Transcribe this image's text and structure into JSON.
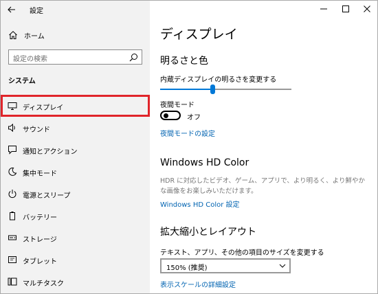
{
  "window": {
    "title": "設定"
  },
  "sidebar": {
    "home_label": "ホーム",
    "search_placeholder": "設定の検索",
    "section_title": "システム",
    "items": [
      {
        "label": "ディスプレイ",
        "icon": "monitor-icon"
      },
      {
        "label": "サウンド",
        "icon": "speaker-icon"
      },
      {
        "label": "通知とアクション",
        "icon": "notification-icon"
      },
      {
        "label": "集中モード",
        "icon": "moon-icon"
      },
      {
        "label": "電源とスリープ",
        "icon": "power-icon"
      },
      {
        "label": "バッテリー",
        "icon": "battery-icon"
      },
      {
        "label": "ストレージ",
        "icon": "storage-icon"
      },
      {
        "label": "タブレット",
        "icon": "tablet-icon"
      },
      {
        "label": "マルチタスク",
        "icon": "multitask-icon"
      }
    ],
    "selected_index": 0,
    "highlight_color": "#e0242a"
  },
  "main": {
    "page_title": "ディスプレイ",
    "brightness": {
      "heading": "明るさと色",
      "slider_label": "内蔵ディスプレイの明るさを変更する",
      "slider_value": 0.4,
      "night_light_label": "夜間モード",
      "night_light_state": "オフ",
      "night_light_link": "夜間モードの設定"
    },
    "hdr": {
      "heading": "Windows HD Color",
      "description": "HDR に対応したビデオ、ゲーム、アプリで、より明るく、より鮮やかな画像をお楽しみいただけます。",
      "link": "Windows HD Color 設定"
    },
    "scale": {
      "heading": "拡大縮小とレイアウト",
      "label": "テキスト、アプリ、その他の項目のサイズを変更する",
      "value": "150% (推奨)",
      "link": "表示スケールの詳細設定"
    },
    "accent_color": "#0078d7",
    "link_color": "#0063b1"
  }
}
